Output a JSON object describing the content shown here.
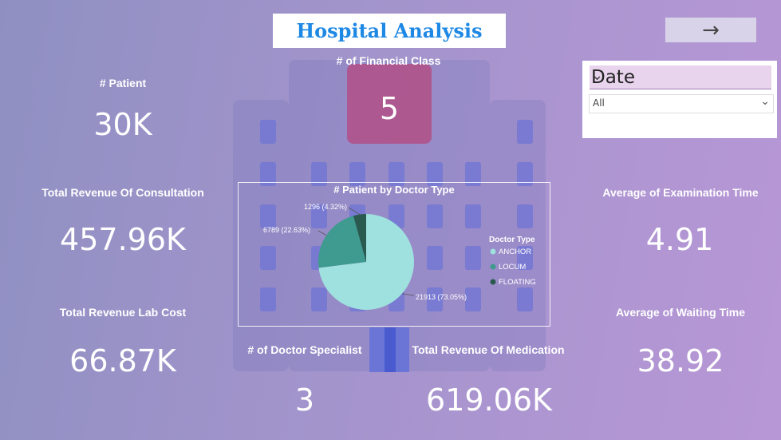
{
  "header": {
    "title": "Hospital Analysis",
    "nav_arrow": "→"
  },
  "kpis": {
    "patient": {
      "label": "# Patient",
      "value": "30K"
    },
    "financial_class": {
      "label": "# of Financial Class",
      "value": "5"
    },
    "rev_consultation": {
      "label": "Total Revenue Of Consultation",
      "value": "457.96K"
    },
    "rev_lab": {
      "label": "Total Revenue Lab Cost",
      "value": "66.87K"
    },
    "doctor_specialist": {
      "label": "# of Doctor Specialist",
      "value": "3"
    },
    "rev_medication": {
      "label": "Total Revenue Of Medication",
      "value": "619.06K"
    },
    "avg_exam": {
      "label": "Average of Examination Time",
      "value": "4.91"
    },
    "avg_wait": {
      "label": "Average of Waiting Time",
      "value": "38.92"
    }
  },
  "slicer": {
    "title": "Date",
    "selected": "All"
  },
  "chart_data": {
    "type": "pie",
    "title": "# Patient by Doctor Type",
    "legend_title": "Doctor Type",
    "legend_position": "right",
    "slices": [
      {
        "name": "ANCHOR",
        "value": 21913,
        "label": "21913 (73.05%)",
        "color": "#9fe1de"
      },
      {
        "name": "LOCUM",
        "value": 6789,
        "label": "6789 (22.63%)",
        "color": "#3f9a8f"
      },
      {
        "name": "FLOATING",
        "value": 1296,
        "label": "1296 (4.32%)",
        "color": "#2a5a4f"
      }
    ]
  }
}
